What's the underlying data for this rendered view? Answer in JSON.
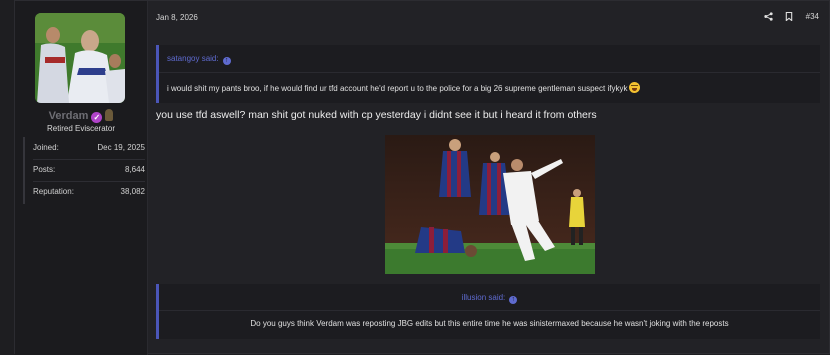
{
  "user": {
    "name": "Verdam",
    "title": "Retired Eviscerator",
    "stats": [
      {
        "label": "Joined:",
        "value": "Dec 19, 2025"
      },
      {
        "label": "Posts:",
        "value": "8,644"
      },
      {
        "label": "Reputation:",
        "value": "38,082"
      }
    ]
  },
  "post": {
    "date": "Jan 8, 2026",
    "number": "#34",
    "message": "you use tfd aswell? man shit got nuked with cp yesterday i didnt see it but i heard it from others"
  },
  "quotes": [
    {
      "author": "satangoy said:",
      "text": "i would shit my pants broo, if he would find ur tfd account he'd report u to the police for a big 26 supreme gentleman suspect ifykyk"
    },
    {
      "author": "illusion said:",
      "text": "Do you guys think Verdam was reposting JBG edits but this entire time he was sinistermaxed because he wasn't joking with the reposts"
    }
  ],
  "icons": {
    "share": "share-icon",
    "bookmark": "bookmark-icon",
    "verified": "verified-badge-icon",
    "rank": "rank-icon",
    "quote_jump": "arrow-up-circle-icon"
  },
  "colors": {
    "accent": "#5f6bd0",
    "verified": "#b043c9",
    "background": "#1e1e21"
  }
}
